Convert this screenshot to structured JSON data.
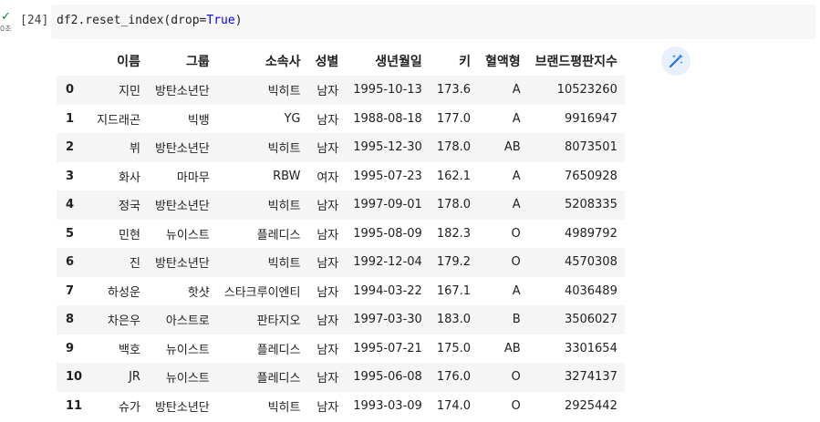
{
  "cell": {
    "status_check": "✓",
    "exec_time": "0초",
    "exec_count": "[24]",
    "code_prefix": "df2.reset_index(drop=",
    "code_true": "True",
    "code_suffix": ")"
  },
  "table": {
    "columns": [
      "",
      "이름",
      "그룹",
      "소속사",
      "성별",
      "생년월일",
      "키",
      "혈액형",
      "브랜드평판지수"
    ],
    "rows": [
      [
        "0",
        "지민",
        "방탄소년단",
        "빅히트",
        "남자",
        "1995-10-13",
        "173.6",
        "A",
        "10523260"
      ],
      [
        "1",
        "지드래곤",
        "빅뱅",
        "YG",
        "남자",
        "1988-08-18",
        "177.0",
        "A",
        "9916947"
      ],
      [
        "2",
        "뷔",
        "방탄소년단",
        "빅히트",
        "남자",
        "1995-12-30",
        "178.0",
        "AB",
        "8073501"
      ],
      [
        "3",
        "화사",
        "마마무",
        "RBW",
        "여자",
        "1995-07-23",
        "162.1",
        "A",
        "7650928"
      ],
      [
        "4",
        "정국",
        "방탄소년단",
        "빅히트",
        "남자",
        "1997-09-01",
        "178.0",
        "A",
        "5208335"
      ],
      [
        "5",
        "민현",
        "뉴이스트",
        "플레디스",
        "남자",
        "1995-08-09",
        "182.3",
        "O",
        "4989792"
      ],
      [
        "6",
        "진",
        "방탄소년단",
        "빅히트",
        "남자",
        "1992-12-04",
        "179.2",
        "O",
        "4570308"
      ],
      [
        "7",
        "하성운",
        "핫샷",
        "스타크루이엔티",
        "남자",
        "1994-03-22",
        "167.1",
        "A",
        "4036489"
      ],
      [
        "8",
        "차은우",
        "아스트로",
        "판타지오",
        "남자",
        "1997-03-30",
        "183.0",
        "B",
        "3506027"
      ],
      [
        "9",
        "백호",
        "뉴이스트",
        "플레디스",
        "남자",
        "1995-07-21",
        "175.0",
        "AB",
        "3301654"
      ],
      [
        "10",
        "JR",
        "뉴이스트",
        "플레디스",
        "남자",
        "1995-06-08",
        "176.0",
        "O",
        "3274137"
      ],
      [
        "11",
        "슈가",
        "방탄소년단",
        "빅히트",
        "남자",
        "1993-03-09",
        "174.0",
        "O",
        "2925442"
      ]
    ]
  },
  "icons": {
    "magic": "magic-wand-icon",
    "accent_color": "#1a73e8"
  }
}
